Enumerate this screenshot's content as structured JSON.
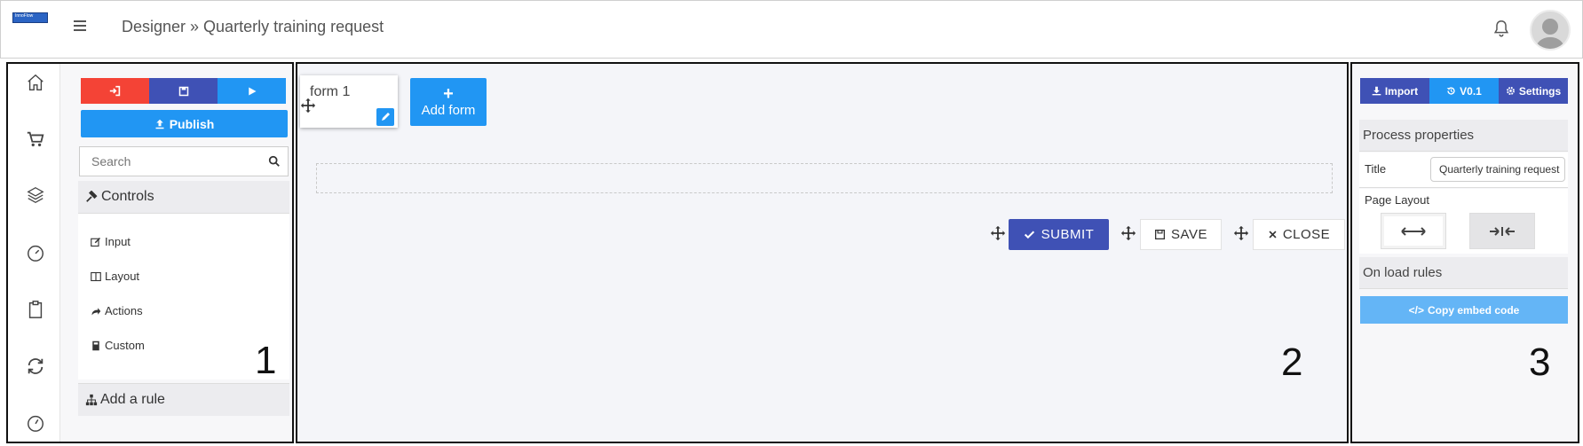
{
  "header": {
    "logo_text": "InnoFlow",
    "breadcrumb": "Designer » Quarterly training request"
  },
  "left_panel": {
    "number": "1",
    "rail_icons": [
      "home-icon",
      "cart-icon",
      "layers-icon",
      "dashboard-icon",
      "clipboard-icon",
      "refresh-icon",
      "gauge-icon"
    ],
    "toolbar": {
      "exit_icon": "sign-in-icon",
      "save_icon": "floppy-icon",
      "run_icon": "play-icon",
      "colors": [
        "#f44336",
        "#3f51b5",
        "#2196f3"
      ]
    },
    "publish_label": "Publish",
    "search_placeholder": "Search",
    "controls_label": "Controls",
    "controls": [
      {
        "label": "Input",
        "icon": "edit-icon"
      },
      {
        "label": "Layout",
        "icon": "columns-icon"
      },
      {
        "label": "Actions",
        "icon": "share-icon"
      },
      {
        "label": "Custom",
        "icon": "calculator-icon"
      }
    ],
    "add_rule_label": "Add a rule"
  },
  "canvas": {
    "number": "2",
    "form_tab_label": "form 1",
    "add_form_label": "Add form",
    "submit_label": "SUBMIT",
    "save_label": "SAVE",
    "close_label": "CLOSE"
  },
  "right_panel": {
    "number": "3",
    "import_label": "Import",
    "version_label": "V0.1",
    "settings_label": "Settings",
    "process_properties_label": "Process properties",
    "title_label": "Title",
    "title_value": "Quarterly training request",
    "page_layout_label": "Page Layout",
    "on_load_rules_label": "On load rules",
    "copy_embed_label": "Copy embed code"
  },
  "colors": {
    "primary": "#2196f3",
    "indigo": "#3f51b5",
    "danger": "#f44336",
    "embed": "#64b5f6"
  }
}
